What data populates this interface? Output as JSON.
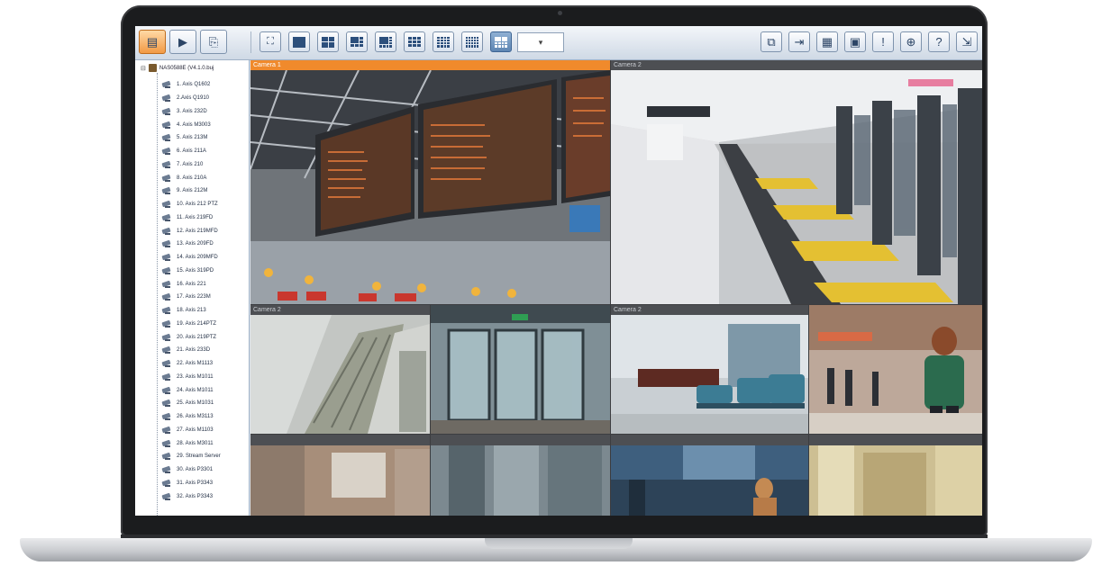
{
  "toolbar": {
    "left_buttons": [
      {
        "name": "monitor-button",
        "icon": "monitor-icon",
        "glyph": "▤"
      },
      {
        "name": "playback-button",
        "icon": "play-icon",
        "glyph": "▶"
      },
      {
        "name": "export-button",
        "icon": "film-export-icon",
        "glyph": "⎘"
      }
    ],
    "dropdown_value": "▾",
    "right_buttons": [
      {
        "name": "window-button",
        "icon": "windows-icon",
        "glyph": "⧉"
      },
      {
        "name": "layout-button",
        "icon": "layout-icon",
        "glyph": "⇥"
      },
      {
        "name": "emap-button",
        "icon": "grid-map-icon",
        "glyph": "▦"
      },
      {
        "name": "snapshot-button",
        "icon": "screen-icon",
        "glyph": "▣"
      },
      {
        "name": "message-button",
        "icon": "message-icon",
        "glyph": "!"
      },
      {
        "name": "web-button",
        "icon": "globe-icon",
        "glyph": "⊕"
      },
      {
        "name": "help-button",
        "icon": "help-icon",
        "glyph": "?"
      },
      {
        "name": "logout-button",
        "icon": "logout-icon",
        "glyph": "⇲"
      }
    ]
  },
  "tree": {
    "root_label": "NAS0588E (V4.1.0.buj",
    "items": [
      "1. Axis Q1602",
      "2.Axis Q1910",
      "3. Axis 232D",
      "4. Axis M3003",
      "5. Axis 213M",
      "6. Axis 211A",
      "7. Axis 210",
      "8. Axis 210A",
      "9. Axis 212M",
      "10. Axis 212 PTZ",
      "11. Axis 219FD",
      "12. Axis 219MFD",
      "13. Axis 209FD",
      "14. Axis 209MFD",
      "15. Axis 319PD",
      "16. Axis 221",
      "17. Axis 223M",
      "18. Axis 213",
      "19. Axis 214PTZ",
      "20. Axis 219PTZ",
      "21. Axis 233D",
      "22. Axis M1113",
      "23. Axis M1011",
      "24. Axis M1011",
      "25. Axis M1031",
      "26. Axis M3113",
      "27. Axis M1103",
      "28. Axis M3011",
      "29. Stream Server",
      "30. Axis P3301",
      "31. Axis P3343",
      "32. Axis P3343"
    ]
  },
  "cameras": {
    "large1": "Camera 1",
    "large2": "Camera 2",
    "small1": "Camera 2",
    "small3": "Camera 2"
  }
}
